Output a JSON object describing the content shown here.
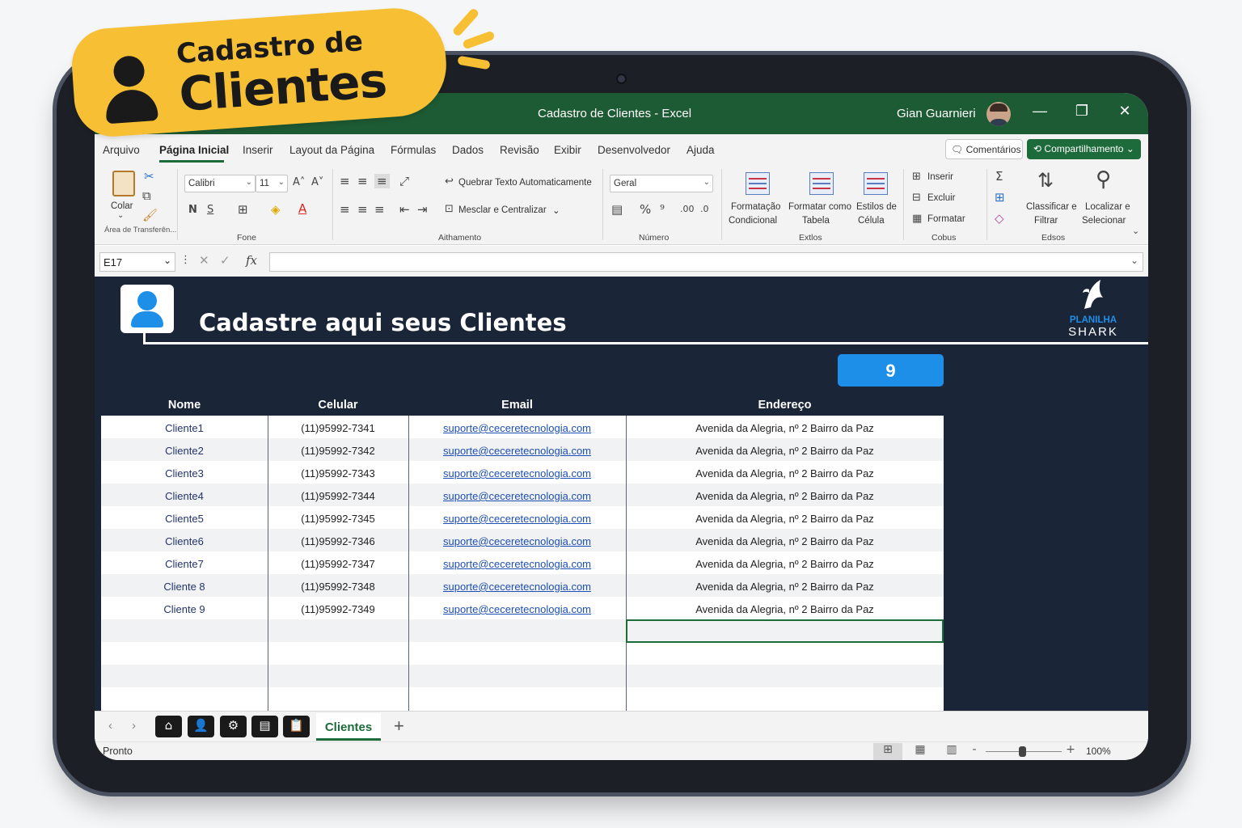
{
  "badge": {
    "line1": "Cadastro de",
    "line2": "Clientes"
  },
  "titlebar": {
    "title": "Cadastro de Clientes  -  Excel",
    "user": "Gian Guarnieri",
    "minimize": "—",
    "restore": "❐",
    "close": "✕"
  },
  "menu": {
    "items": [
      "Arquivo",
      "Página Inicial",
      "Inserir",
      "Layout da Página",
      "Fórmulas",
      "Dados",
      "Revisão",
      "Exibir",
      "Desenvolvedor",
      "Ajuda"
    ],
    "active": "Página Inicial",
    "comments": "Comentários",
    "share": "Compartilhamento"
  },
  "ribbon": {
    "clipboard": {
      "paste": "Colar",
      "group": "Área de Transferên..."
    },
    "font": {
      "name": "Calibri",
      "size": "11",
      "group": "Fone",
      "bold": "N",
      "underline": "S"
    },
    "alignment": {
      "wrap": "Quebrar Texto Automaticamente",
      "merge": "Mesclar e Centralizar",
      "group": "Aithamento"
    },
    "number": {
      "format": "Geral",
      "group": "Número"
    },
    "styles": {
      "conditional_1": "Formatação",
      "conditional_2": "Condicional",
      "table_1": "Formatar como",
      "table_2": "Tabela",
      "cell_1": "Estilos de",
      "cell_2": "Célula",
      "group": "Extlos"
    },
    "cells": {
      "insert": "Inserir",
      "delete": "Excluir",
      "format": "Formatar",
      "group": "Cobus"
    },
    "editing": {
      "sort_1": "Classificar e",
      "sort_2": "Filtrar",
      "find_1": "Localizar e",
      "find_2": "Selecionar",
      "group": "Edsos"
    }
  },
  "formula_bar": {
    "cell_ref": "E17",
    "fx": "fx",
    "value": ""
  },
  "sheet": {
    "title": "Cadastre aqui seus Clientes",
    "logo_line1": "PLANILHA",
    "logo_line2": "SHARK",
    "count": "9",
    "headers": [
      "Nome",
      "Celular",
      "Email",
      "Endereço"
    ],
    "rows": [
      {
        "nome": "Cliente1",
        "celular": "(11)95992-7341",
        "email": "suporte@ceceretecnologia.com",
        "endereco": "Avenida da Alegria, nº 2 Bairro da Paz"
      },
      {
        "nome": "Cliente2",
        "celular": "(11)95992-7342",
        "email": "suporte@ceceretecnologia.com",
        "endereco": "Avenida da Alegria, nº 2 Bairro da Paz"
      },
      {
        "nome": "Cliente3",
        "celular": "(11)95992-7343",
        "email": "suporte@ceceretecnologia.com",
        "endereco": "Avenida da Alegria, nº 2 Bairro da Paz"
      },
      {
        "nome": "Cliente4",
        "celular": "(11)95992-7344",
        "email": "suporte@ceceretecnologia.com",
        "endereco": "Avenida da Alegria, nº 2 Bairro da Paz"
      },
      {
        "nome": "Cliente5",
        "celular": "(11)95992-7345",
        "email": "suporte@ceceretecnologia.com",
        "endereco": "Avenida da Alegria, nº 2 Bairro da Paz"
      },
      {
        "nome": "Cliente6",
        "celular": "(11)95992-7346",
        "email": "suporte@ceceretecnologia.com",
        "endereco": "Avenida da Alegria, nº 2 Bairro da Paz"
      },
      {
        "nome": "Cliente7",
        "celular": "(11)95992-7347",
        "email": "suporte@ceceretecnologia.com",
        "endereco": "Avenida da Alegria, nº 2 Bairro da Paz"
      },
      {
        "nome": "Cliente 8",
        "celular": "(11)95992-7348",
        "email": "suporte@ceceretecnologia.com",
        "endereco": "Avenida da Alegria, nº 2 Bairro da Paz"
      },
      {
        "nome": "Cliente 9",
        "celular": "(11)95992-7349",
        "email": "suporte@ceceretecnologia.com",
        "endereco": "Avenida da Alegria, nº 2 Bairro da Paz"
      }
    ]
  },
  "tabs": {
    "active_sheet": "Clientes",
    "add": "+",
    "icons": [
      "home-icon",
      "user-icon",
      "gear-icon",
      "document-icon",
      "clipboard-icon"
    ]
  },
  "status": {
    "text": "Pronto",
    "zoom": "100%"
  },
  "colors": {
    "excel_green": "#1d6b3a",
    "titlebar_green": "#1d5b34",
    "sheet_bg": "#1b2538",
    "accent_blue": "#1e8fe8",
    "badge_yellow": "#f7c034"
  }
}
